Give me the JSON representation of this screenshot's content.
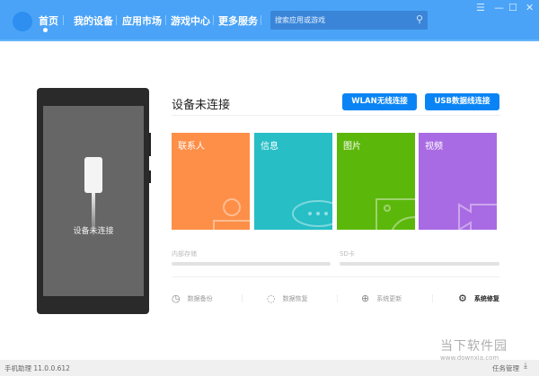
{
  "header": {
    "nav": [
      "首页",
      "我的设备",
      "应用市场",
      "游戏中心",
      "更多服务"
    ],
    "active_index": 0,
    "search_placeholder": "搜索应用或游戏",
    "window_controls": [
      "menu-icon",
      "minimize-icon",
      "maximize-icon",
      "close-icon"
    ]
  },
  "device": {
    "screen_text": "设备未连接",
    "status_title": "设备未连接",
    "wlan_button": "WLAN无线连接",
    "usb_button": "USB数据线连接"
  },
  "tiles": [
    {
      "label": "联系人",
      "color": "#fd8f48",
      "icon": "contact-icon"
    },
    {
      "label": "信息",
      "color": "#27bec6",
      "icon": "message-icon"
    },
    {
      "label": "图片",
      "color": "#5cb70b",
      "icon": "picture-icon"
    },
    {
      "label": "视频",
      "color": "#a96be3",
      "icon": "video-icon"
    }
  ],
  "storage": {
    "internal_label": "内部存储",
    "sd_label": "SD卡"
  },
  "actions": [
    {
      "label": "数据备份",
      "icon": "clock-icon"
    },
    {
      "label": "数据恢复",
      "icon": "restore-icon"
    },
    {
      "label": "系统更新",
      "icon": "upload-icon"
    },
    {
      "label": "系统修复",
      "icon": "gear-icon"
    }
  ],
  "footer": {
    "version": "手机助理 11.0.0.612",
    "task_manager": "任务管理"
  },
  "watermark": {
    "text": "当下软件园",
    "url": "www.downxia.com"
  }
}
